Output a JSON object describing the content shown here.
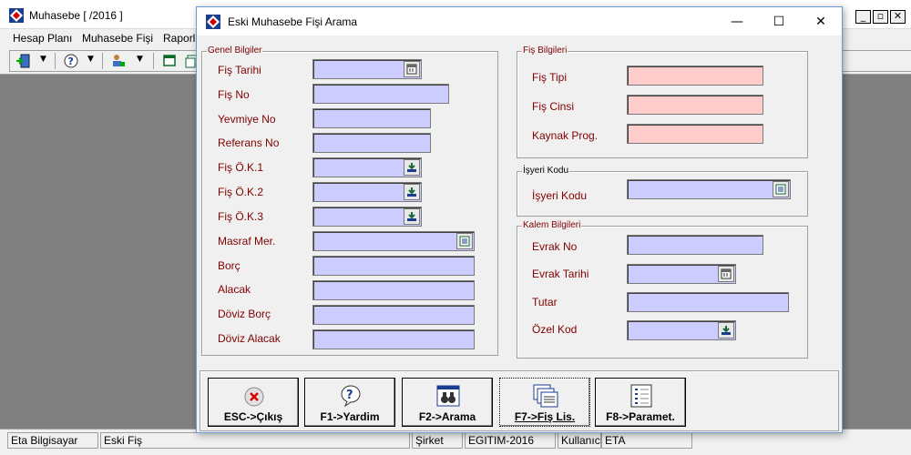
{
  "app": {
    "title": "Muhasebe [ /2016 ]",
    "menu": [
      {
        "label": "Hesap Planı",
        "accel": "H"
      },
      {
        "label": "Muhasebe Fişi",
        "accel": "M"
      },
      {
        "label": "Raporlar",
        "accel": "R"
      }
    ]
  },
  "mdi_controls": {
    "minimize": "_",
    "restore": "▫",
    "close": "✕"
  },
  "dialog": {
    "title": "Eski Muhasebe Fişi Arama",
    "controls": {
      "minimize": "—",
      "maximize": "☐",
      "close": "✕"
    },
    "genel": {
      "legend": "Genel Bilgiler",
      "fields": [
        {
          "label": "Fiş Tarihi",
          "value": "",
          "button": "calendar-icon"
        },
        {
          "label": "Fiş No",
          "value": ""
        },
        {
          "label": "Yevmiye No",
          "value": ""
        },
        {
          "label": "Referans No",
          "value": ""
        },
        {
          "label": "Fiş Ö.K.1",
          "value": "",
          "button": "lookup-icon"
        },
        {
          "label": "Fiş Ö.K.2",
          "value": "",
          "button": "lookup-icon"
        },
        {
          "label": "Fiş Ö.K.3",
          "value": "",
          "button": "lookup-icon"
        },
        {
          "label": "Masraf Mer.",
          "value": "",
          "button": "list-icon"
        },
        {
          "label": "Borç",
          "value": ""
        },
        {
          "label": "Alacak",
          "value": ""
        },
        {
          "label": "Döviz Borç",
          "value": ""
        },
        {
          "label": "Döviz Alacak",
          "value": ""
        }
      ]
    },
    "fis": {
      "legend": "Fiş Bilgileri",
      "fields": [
        {
          "label": "Fiş Tipi",
          "value": ""
        },
        {
          "label": "Fiş Cinsi",
          "value": ""
        },
        {
          "label": "Kaynak Prog.",
          "value": ""
        }
      ]
    },
    "isyeri": {
      "legend": "İşyeri Kodu",
      "fields": [
        {
          "label": "İşyeri Kodu",
          "value": "",
          "button": "list-icon"
        }
      ]
    },
    "kalem": {
      "legend": "Kalem Bilgileri",
      "fields": [
        {
          "label": "Evrak No",
          "value": ""
        },
        {
          "label": "Evrak Tarihi",
          "value": "",
          "button": "calendar-icon"
        },
        {
          "label": "Tutar",
          "value": ""
        },
        {
          "label": "Özel Kod",
          "value": "",
          "button": "lookup-icon"
        }
      ]
    },
    "buttons": [
      {
        "label": "ESC->Çıkış",
        "icon": "close-circle-icon"
      },
      {
        "label": "F1->Yardim",
        "icon": "help-icon"
      },
      {
        "label": "F2->Arama",
        "icon": "search-binoculars-icon"
      },
      {
        "label": "F7->Fiş Lis.",
        "icon": "documents-list-icon"
      },
      {
        "label": "F8->Paramet.",
        "icon": "parameters-icon"
      }
    ]
  },
  "status": {
    "company_host": "Eta Bilgisayar",
    "module": "Eski Fiş",
    "sirket_label": "Şirket",
    "sirket_value": "EGITIM-2016",
    "kullanici_label": "Kullanıcı",
    "kullanici_value": "ETA"
  },
  "colors": {
    "label_text": "#800000",
    "field_blue": "#ccccff",
    "field_pink": "#ffcccc",
    "desktop": "#808080"
  }
}
